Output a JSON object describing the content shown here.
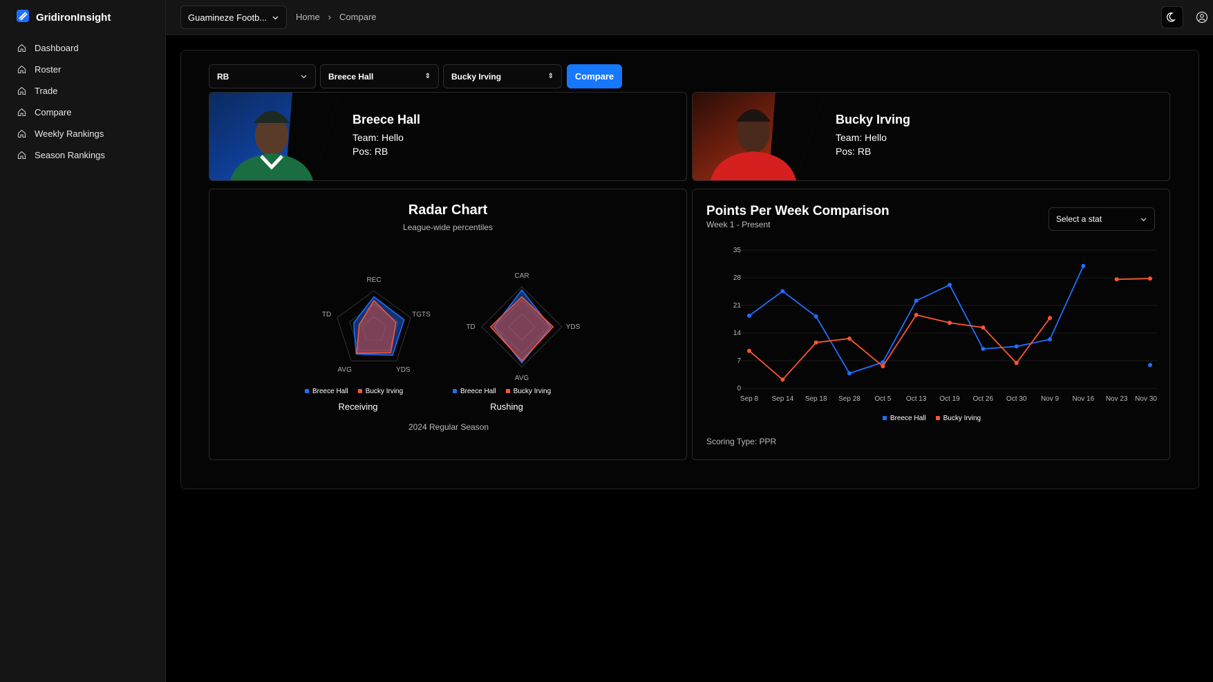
{
  "app": {
    "name": "GridironInsight"
  },
  "sidebar": {
    "items": [
      {
        "label": "Dashboard"
      },
      {
        "label": "Roster"
      },
      {
        "label": "Trade"
      },
      {
        "label": "Compare"
      },
      {
        "label": "Weekly Rankings"
      },
      {
        "label": "Season Rankings"
      }
    ]
  },
  "header": {
    "team": "Guamineze Footb...",
    "breadcrumb": [
      "Home",
      "Compare"
    ]
  },
  "compare": {
    "position": "RB",
    "player1": "Breece Hall",
    "player2": "Bucky Irving",
    "button": "Compare"
  },
  "players": [
    {
      "name": "Breece Hall",
      "team": "Team: Hello",
      "pos": "Pos: RB",
      "color": "#1f6fff"
    },
    {
      "name": "Bucky Irving",
      "team": "Team: Hello",
      "pos": "Pos: RB",
      "color": "#ff5533"
    }
  ],
  "radar": {
    "title": "Radar Chart",
    "subtitle": "League-wide percentiles",
    "season": "2024 Regular Season",
    "legend": [
      "Breece Hall",
      "Bucky Irving"
    ],
    "receiving": {
      "label": "Receiving",
      "axes": [
        "REC",
        "TGTS",
        "YDS",
        "AVG",
        "TD"
      ],
      "breece": [
        0.85,
        0.82,
        0.82,
        0.78,
        0.55
      ],
      "bucky": [
        0.75,
        0.6,
        0.74,
        0.76,
        0.4
      ]
    },
    "rushing": {
      "label": "Rushing",
      "axes": [
        "CAR",
        "YDS",
        "AVG",
        "TD"
      ],
      "breece": [
        0.92,
        0.72,
        0.9,
        0.7
      ],
      "bucky": [
        0.75,
        0.78,
        0.85,
        0.78
      ]
    }
  },
  "points": {
    "title": "Points Per Week Comparison",
    "subtitle": "Week 1 - Present",
    "select": "Select a stat",
    "scoring": "Scoring Type: PPR",
    "legend": [
      "Breece Hall",
      "Bucky Irving"
    ]
  },
  "chart_data": {
    "type": "line",
    "categories": [
      "Sep 8",
      "Sep 14",
      "Sep 18",
      "Sep 28",
      "Oct 5",
      "Oct 13",
      "Oct 19",
      "Oct 26",
      "Oct 30",
      "Nov 9",
      "Nov 16",
      "Nov 23",
      "Nov 30"
    ],
    "series": [
      {
        "name": "Breece Hall",
        "color": "#1f6fff",
        "values": [
          18.4,
          24.6,
          18.2,
          3.8,
          6.6,
          22.2,
          26.2,
          10,
          10.6,
          12.4,
          31,
          null,
          5.9
        ]
      },
      {
        "name": "Bucky Irving",
        "color": "#ff5533",
        "values": [
          9.5,
          2.2,
          11.6,
          12.6,
          5.6,
          18.6,
          16.6,
          15.4,
          6.4,
          17.8,
          null,
          27.6,
          27.8
        ]
      }
    ],
    "yticks": [
      0,
      7,
      14,
      21,
      28,
      35
    ],
    "ylim": [
      0,
      35
    ]
  }
}
